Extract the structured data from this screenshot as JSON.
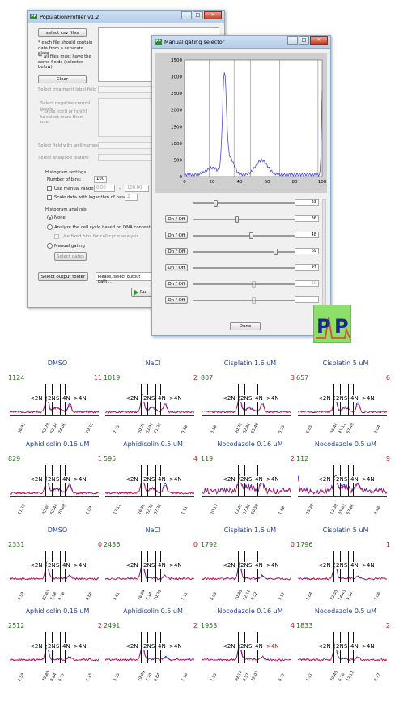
{
  "main_window": {
    "title": "PopulationProfiler v1.2",
    "app_icon": "PP",
    "select_csv_label": "select csv files",
    "note1": "* each file should contain data from a separate plate",
    "note2": "** all files must have the same fields (selected below)",
    "clear_label": "Clear",
    "treatment_label": "Select treatment label field",
    "neg_ctrl_label": "Select negative control labels",
    "neg_ctrl_hint": "* press [ctrl] or [shift] to select more then one",
    "well_names_label": "Select field with well names",
    "analyzed_feature_label": "Select analyzed feature",
    "hist_settings_label": "Histogram settings",
    "bins_label": "Number of bins:",
    "bins_value": "100",
    "manual_range_label": "Use manual range:",
    "range_min": "0.00",
    "range_dash": "-",
    "range_max": "100.00",
    "log_label": "Scale data with logarithm of base:",
    "log_value": "2",
    "hist_analysis_label": "Histogram analysis",
    "radio_none": "None",
    "radio_dna": "Analyze the cell cycle based on DNA content (autom",
    "fixed_bins_label": "Use fixed bins for cell cycle analysis",
    "radio_manual": "Manual gating",
    "select_gates_label": "Select gates",
    "select_output_label": "Select output folder",
    "output_path": "Please, select output path...",
    "run_label": "Ru"
  },
  "gating_window": {
    "title": "Manual gating selector",
    "app_icon": "PP",
    "y_ticks": [
      "3500",
      "3000",
      "2500",
      "2000",
      "1500",
      "1000",
      "500",
      "0"
    ],
    "x_ticks": [
      "0",
      "20",
      "40",
      "60",
      "80",
      "100"
    ],
    "y_max": 3500,
    "x_max": 100,
    "gates": [
      18,
      36,
      48,
      69,
      97,
      50,
      50
    ],
    "gate_values": [
      "23",
      "36",
      "48",
      "69",
      "97",
      "50",
      ""
    ],
    "onoff_label": "On / Off",
    "done_label": "Done",
    "logo_letters": [
      "P",
      "P"
    ]
  },
  "panels": [
    {
      "title": "DMSO",
      "count": "1124",
      "flag": "11",
      "xticks": [
        "36.93",
        "53.70",
        "63.34",
        "74.06",
        "79.15",
        "86.32",
        "92.45"
      ]
    },
    {
      "title": "NaCl",
      "count": "1019",
      "flag": "2",
      "xticks": [
        "7.75",
        "30.74",
        "63.94",
        "71.26",
        "0.68"
      ]
    },
    {
      "title": "Cisplatin 1.6 uM",
      "count": "807",
      "flag": "3",
      "xticks": [
        "3.58",
        "40.76",
        "62.82",
        "65.48",
        "0.25"
      ]
    },
    {
      "title": "Cisplatin 5 uM",
      "count": "657",
      "flag": "6",
      "xticks": [
        "6.85",
        "36.44",
        "41.11",
        "67.49",
        "3.04"
      ]
    },
    {
      "title": "Aphidicolin 0.16 uM",
      "count": "829",
      "flag": "1",
      "xticks": [
        "11.10",
        "32.65",
        "62.44",
        "70.69",
        "1.09"
      ]
    },
    {
      "title": "Aphidicolin 0.5 uM",
      "count": "595",
      "flag": "4",
      "xticks": [
        "13.11",
        "26.56",
        "52.72",
        "67.22",
        "1.51"
      ]
    },
    {
      "title": "Nocodazole 0.16 uM",
      "count": "119",
      "flag": "2",
      "xticks": [
        "20.17",
        "13.45",
        "37.82",
        "60.50",
        "1.68"
      ]
    },
    {
      "title": "Nocodazole 0.5 uM",
      "count": "112",
      "flag": "9",
      "xticks": [
        "23.39",
        "13.39",
        "35.63",
        "67.86",
        "4.46"
      ]
    },
    {
      "title": "DMSO",
      "count": "2331",
      "flag": "0",
      "xticks": [
        "4.59",
        "82.63",
        "7.98",
        "4.78",
        "0.86"
      ]
    },
    {
      "title": "NaCl",
      "count": "2436",
      "flag": "0",
      "xticks": [
        "3.61",
        "76.84",
        "7.14",
        "10.30",
        "1.11"
      ]
    },
    {
      "title": "Cisplatin 1.6 uM",
      "count": "1792",
      "flag": "0",
      "xticks": [
        "6.03",
        "70.88",
        "12.11",
        "8.32",
        "3.57"
      ]
    },
    {
      "title": "Cisplatin 5 uM",
      "count": "1796",
      "flag": "1",
      "xticks": [
        "1.84",
        "73.55",
        "14.43",
        "9.14",
        "1.06"
      ]
    },
    {
      "title": "Aphidicolin 0.16 uM",
      "count": "2512",
      "flag": "2",
      "xticks": [
        "2.59",
        "78.85",
        "8.24",
        "6.77",
        "1.15"
      ]
    },
    {
      "title": "Aphidicolin 0.5 uM",
      "count": "2491",
      "flag": "2",
      "xticks": [
        "3.25",
        "79.09",
        "7.70",
        "8.84",
        "1.36"
      ]
    },
    {
      "title": "Nocodazole 0.16 uM",
      "count": "1953",
      "flag": "4",
      "xticks": [
        "1.95",
        "69.17",
        "6.97",
        "22.07",
        "0.77"
      ]
    },
    {
      "title": "Nocodazole 0.5 uM",
      "count": "1833",
      "flag": "2",
      "xticks": [
        "1.91",
        "79.45",
        "6.76",
        "12.11",
        "0.77"
      ]
    }
  ],
  "phase_labels": {
    "lt2n": "<2N",
    "n2": "2N",
    "s": "S",
    "n4": "4N",
    "gt4n": ">4N"
  },
  "colors": {
    "title_blue": "#1f3fa6",
    "count_green": "#2c6b1f",
    "flag_red": "#c21b1b",
    "trace_blue": "#1010e0",
    "trace_red": "#e0103a",
    "curve_blue": "#4b4bd6"
  }
}
